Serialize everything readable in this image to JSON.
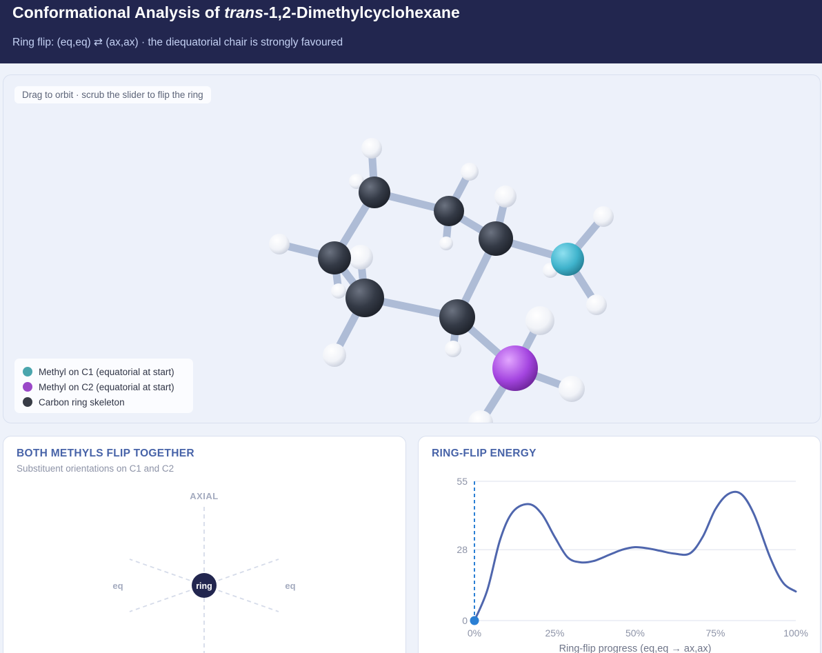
{
  "header": {
    "title_before": "Conformational Analysis of ",
    "title_italic": "trans",
    "title_after": "-1,2-Dimethylcyclohexane",
    "subtitle": "Ring flip: (eq,eq) ⇄ (ax,ax) · the diequatorial chair is strongly favoured"
  },
  "viewer": {
    "hint": "Drag to orbit · scrub the slider to flip the ring",
    "legend": [
      {
        "label": "Methyl on C1 (equatorial at start)",
        "color": "#4aa5ad"
      },
      {
        "label": "Methyl on C2 (equatorial at start)",
        "color": "#9a48c8"
      },
      {
        "label": "Carbon ring skeleton",
        "color": "#383c46"
      }
    ]
  },
  "orientation_card": {
    "title": "BOTH METHYLS FLIP TOGETHER",
    "subtitle": "Substituent orientations on C1 and C2",
    "axial_label": "AXIAL",
    "eq_left_label": "eq",
    "eq_right_label": "eq",
    "center_label": "ring"
  },
  "energy_card": {
    "title": "RING-FLIP ENERGY",
    "chart_data": {
      "type": "line",
      "xlabel": "Ring-flip progress (eq,eq → ax,ax)",
      "ylabel": "",
      "x_ticks": [
        "0%",
        "25%",
        "50%",
        "75%",
        "100%"
      ],
      "y_ticks": [
        0,
        28,
        55
      ],
      "xlim": [
        0,
        100
      ],
      "ylim": [
        0,
        55
      ],
      "marker_x": 0,
      "series": [
        {
          "x": [
            0,
            4,
            8,
            12,
            17,
            21,
            25,
            29,
            33,
            37,
            42,
            46,
            50,
            54,
            58,
            62,
            67,
            71,
            75,
            79,
            83,
            87,
            92,
            96,
            100
          ],
          "y": [
            0,
            12,
            32,
            43,
            46,
            42,
            33,
            25,
            23,
            23.5,
            26,
            28,
            29,
            28.5,
            27.5,
            26.5,
            26.5,
            33,
            44,
            50,
            50,
            42,
            25,
            15,
            11.5
          ]
        }
      ]
    }
  }
}
